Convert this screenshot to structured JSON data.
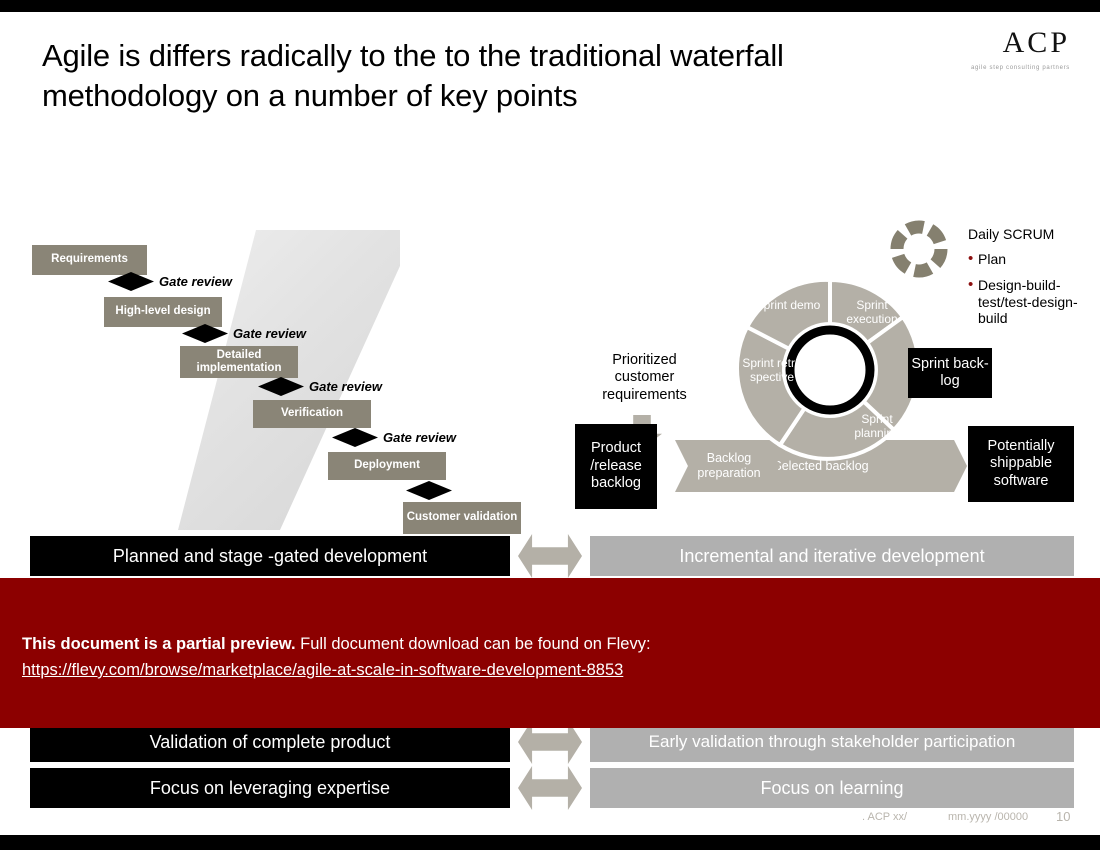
{
  "slide": {
    "title": "Agile is differs radically to the to the traditional waterfall methodology on a number of key points",
    "logo_mark": "ACP",
    "logo_tagline": "agile step consulting partners"
  },
  "waterfall": {
    "stages": [
      {
        "label": "Requirements"
      },
      {
        "label": "High-level design"
      },
      {
        "label": "Detailed implementation"
      },
      {
        "label": "Verification"
      },
      {
        "label": "Deployment"
      },
      {
        "label": "Customer validation"
      }
    ],
    "gates": [
      {
        "label": "Gate review"
      },
      {
        "label": "Gate review"
      },
      {
        "label": "Gate review"
      },
      {
        "label": "Gate review"
      },
      {
        "label": ""
      }
    ]
  },
  "agile": {
    "prioritized_requirements": "Prioritized customer requirements",
    "product_release_backlog": "Product /release backlog",
    "backlog_preparation": "Backlog preparation",
    "selected_backlog": "Selected backlog",
    "sprint_backlog": "Sprint back-log",
    "potentially_shippable": "Potentially shippable software",
    "wheel_segments": [
      {
        "label": "Sprint demo"
      },
      {
        "label": "Sprint execution"
      },
      {
        "label": "Sprint planning"
      },
      {
        "label": "Sprint retro spective"
      }
    ],
    "daily_scrum": {
      "heading": "Daily SCRUM",
      "items": [
        {
          "label": "Plan"
        },
        {
          "label": "Design-build-test/test-design-build"
        }
      ]
    }
  },
  "comparison": {
    "rows": [
      {
        "left": "Planned  and stage -gated  development",
        "right": "Incremental  and iterative development"
      },
      {
        "left": "Validation  of complete  product",
        "right": "Early  validation  through  stakeholder participation"
      },
      {
        "left": "Focus on   leveraging  expertise",
        "right": "Focus on   learning"
      }
    ]
  },
  "banner": {
    "bold": "This document is a partial preview.",
    "rest": "Full document download can be found on Flevy:",
    "url": "https://flevy.com/browse/marketplace/agile-at-scale-in-software-development-8853"
  },
  "footer": {
    "left": ". ACP xx/",
    "middle": "mm.yyyy /00000",
    "page": "10"
  },
  "colors": {
    "taupe": "#8a8577",
    "gray": "#b0b0b0",
    "red": "#8c0000",
    "black": "#000000"
  }
}
